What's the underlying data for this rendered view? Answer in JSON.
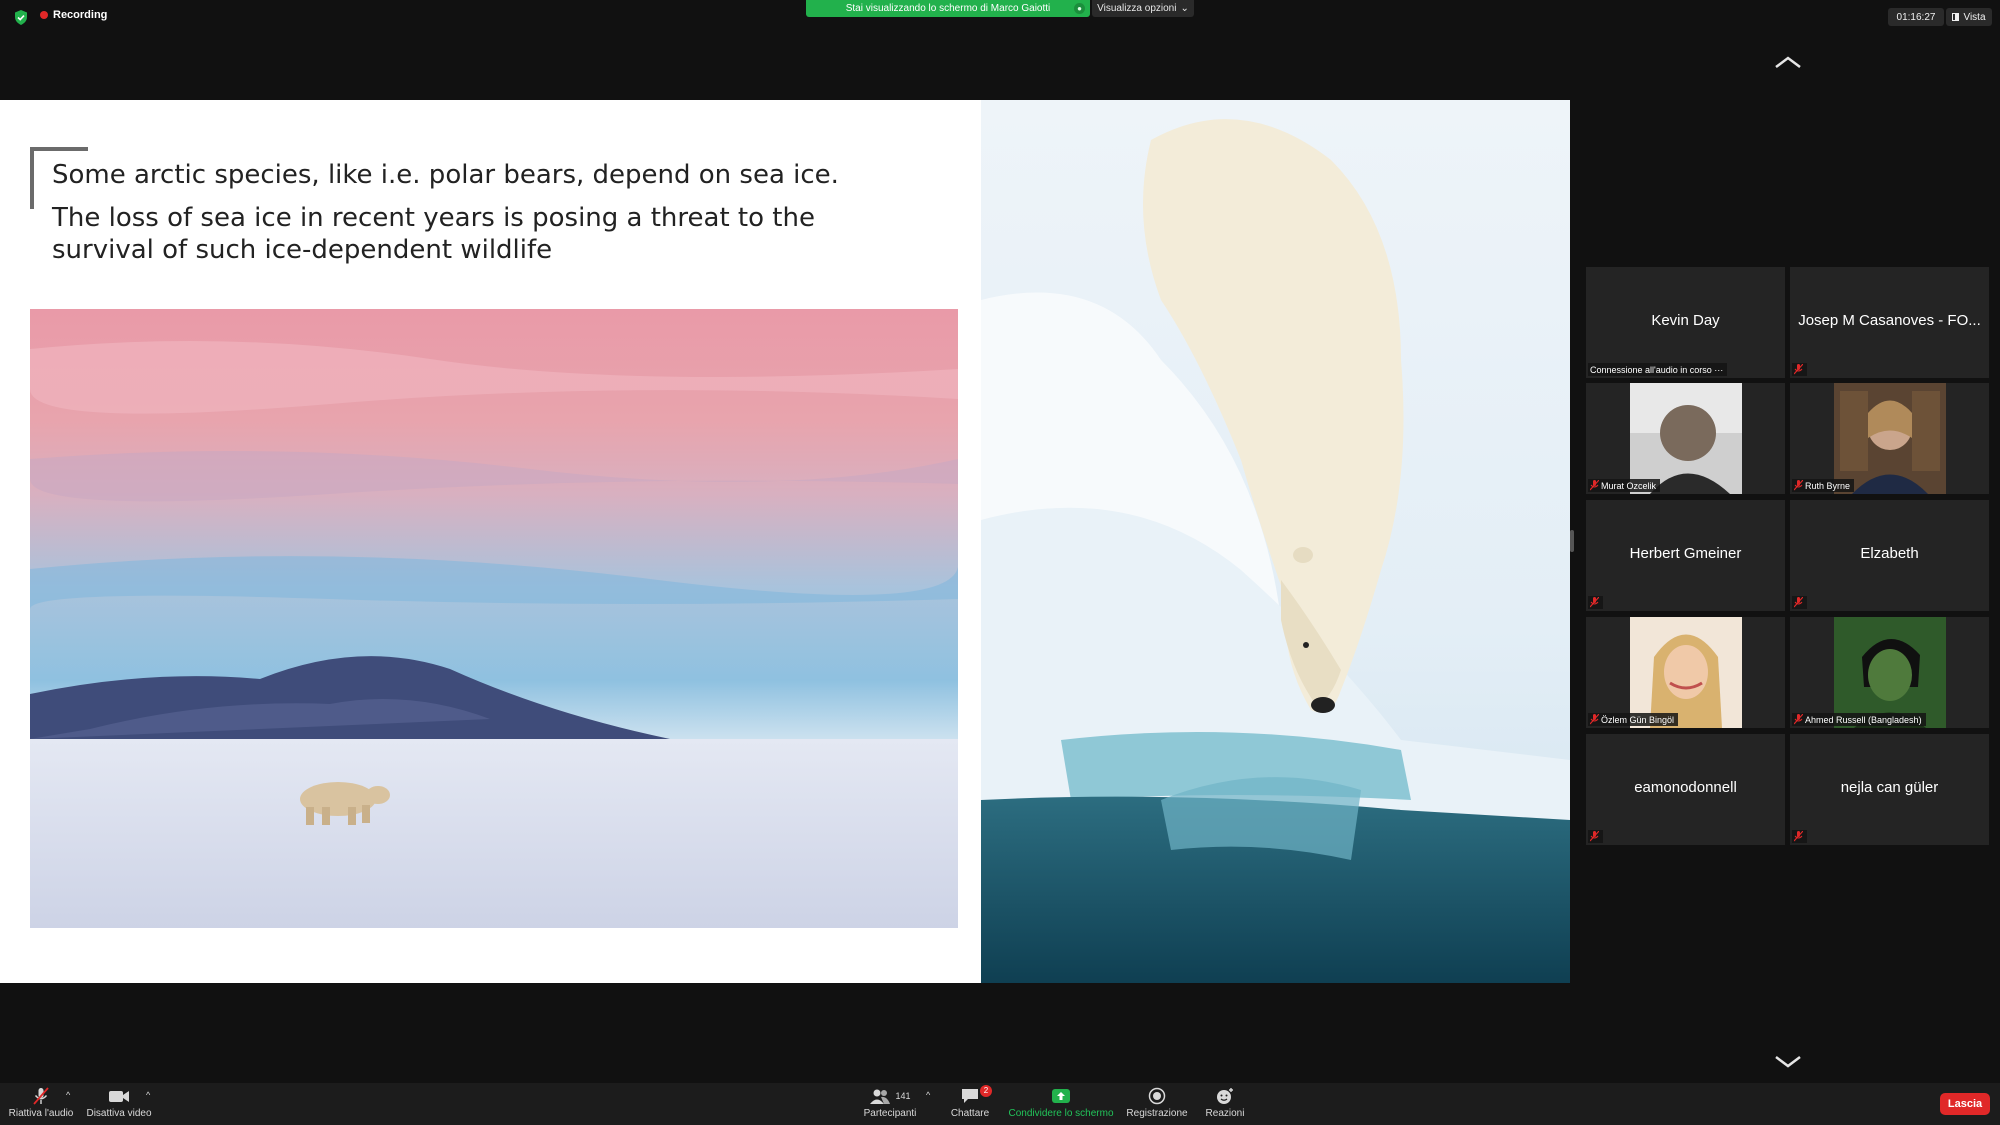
{
  "topbar": {
    "recording_label": "Recording",
    "share_banner": "Stai visualizzando lo schermo di Marco Gaiotti",
    "view_options": "Visualizza opzioni",
    "clock": "01:16:27",
    "view_label": "Vista"
  },
  "slide": {
    "line1": "Some arctic species, like i.e. polar bears, depend on sea ice.",
    "line2": "The loss of sea ice in recent years is posing a threat to the survival of such ice-dependent wildlife"
  },
  "gallery": {
    "tiles": [
      {
        "name": "Kevin Day",
        "label": "Connessione all'audio in corso ···"
      },
      {
        "name": "Josep M Casanoves - FO...",
        "label": ""
      },
      {
        "name": "",
        "label": "Murat Ozcelik"
      },
      {
        "name": "",
        "label": "Ruth Byrne"
      },
      {
        "name": "Herbert Gmeiner",
        "label": ""
      },
      {
        "name": "Elzabeth",
        "label": ""
      },
      {
        "name": "",
        "label": "Özlem Gün Bingöl"
      },
      {
        "name": "",
        "label": "Ahmed Russell (Bangladesh)"
      },
      {
        "name": "eamonodonnell",
        "label": ""
      },
      {
        "name": "nejla can güler",
        "label": ""
      }
    ]
  },
  "toolbar": {
    "unmute": "Riattiva l'audio",
    "video": "Disattiva video",
    "participants": "Partecipanti",
    "participants_count": "141",
    "chat": "Chattare",
    "chat_badge": "2",
    "share": "Condividere lo schermo",
    "record": "Registrazione",
    "reactions": "Reazioni",
    "leave": "Lascia"
  },
  "colors": {
    "share_green": "#22b14c",
    "leave_red": "#e02828",
    "tile_bg": "#242424"
  }
}
